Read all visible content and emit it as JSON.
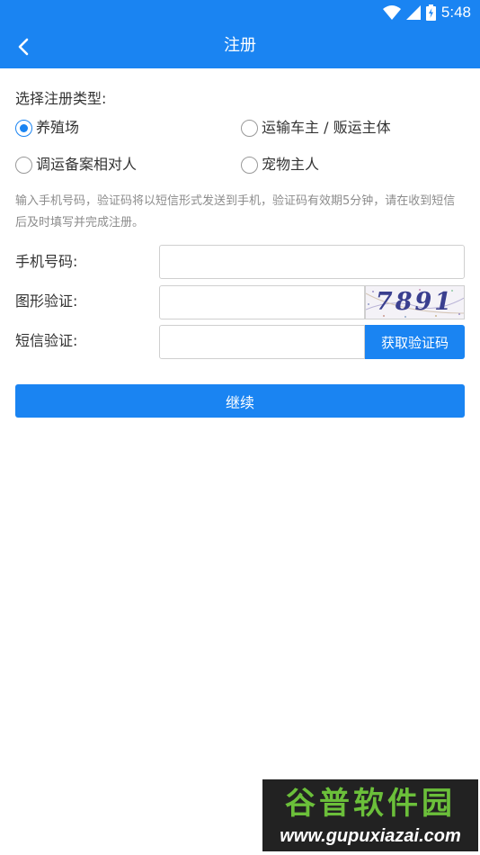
{
  "status_bar": {
    "time": "5:48",
    "icons": [
      "wifi-icon",
      "signal-icon",
      "battery-charging-icon"
    ]
  },
  "header": {
    "title": "注册",
    "back_icon": "chevron-left-icon",
    "background_color": "#1a84f2"
  },
  "registration_type": {
    "label": "选择注册类型:",
    "options": [
      {
        "label": "养殖场",
        "selected": true
      },
      {
        "label": "运输车主 / 贩运主体",
        "selected": false
      },
      {
        "label": "调运备案相对人",
        "selected": false
      },
      {
        "label": "宠物主人",
        "selected": false
      }
    ]
  },
  "notice": "输入手机号码，验证码将以短信形式发送到手机，验证码有效期5分钟，请在收到短信后及时填写并完成注册。",
  "form": {
    "phone_label": "手机号码:",
    "phone_value": "",
    "captcha_label": "图形验证:",
    "captcha_value": "",
    "captcha_image_text": "7891",
    "sms_label": "短信验证:",
    "sms_value": "",
    "sms_button_label": "获取验证码"
  },
  "continue_button_label": "继续",
  "watermark": {
    "title": "谷普软件园",
    "url": "www.gupuxiazai.com"
  },
  "colors": {
    "accent": "#1a84f2",
    "notice_text": "#8c8c8c"
  }
}
